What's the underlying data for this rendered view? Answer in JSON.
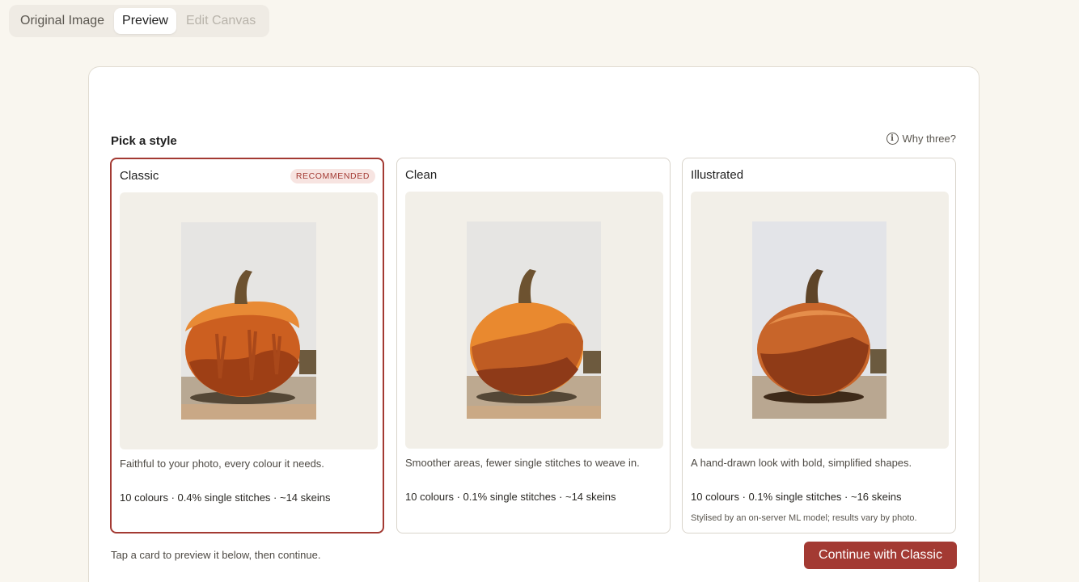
{
  "tabs": [
    {
      "label": "Original Image",
      "state": "default"
    },
    {
      "label": "Preview",
      "state": "active"
    },
    {
      "label": "Edit Canvas",
      "state": "disabled"
    }
  ],
  "section_title": "Pick a style",
  "why_link": {
    "label": "Why three?",
    "icon": "info-icon"
  },
  "cards": [
    {
      "title": "Classic",
      "badge": "RECOMMENDED",
      "selected": true,
      "description": "Faithful to your photo, every colour it needs.",
      "stats": "10 colours · 0.4% single stitches · ~14 skeins",
      "note": ""
    },
    {
      "title": "Clean",
      "badge": "",
      "selected": false,
      "description": "Smoother areas, fewer single stitches to weave in.",
      "stats": "10 colours · 0.1% single stitches · ~14 skeins",
      "note": ""
    },
    {
      "title": "Illustrated",
      "badge": "",
      "selected": false,
      "description": "A hand-drawn look with bold, simplified shapes.",
      "stats": "10 colours · 0.1% single stitches · ~16 skeins",
      "note": "Stylised by an on-server ML model; results vary by photo."
    }
  ],
  "footer": {
    "hint": "Tap a card to preview it below, then continue.",
    "cta_label": "Continue with Classic"
  },
  "colors": {
    "accent": "#a33a33",
    "badge_bg": "#f7e4e1",
    "page_bg": "#f9f6ef"
  }
}
